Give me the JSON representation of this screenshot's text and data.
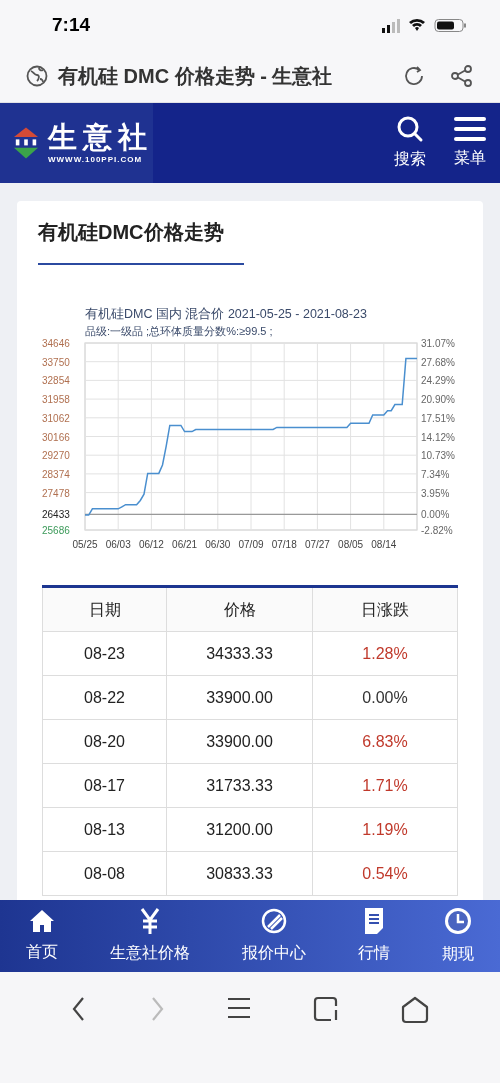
{
  "status_bar": {
    "time": "7:14"
  },
  "browser": {
    "page_title": "有机硅 DMC 价格走势 - 生意社"
  },
  "site_header": {
    "logo_name": "生意社",
    "logo_url": "WWWW.100PPI.COM",
    "actions": [
      {
        "label": "搜索",
        "kind": "search"
      },
      {
        "label": "菜单",
        "kind": "menu"
      }
    ]
  },
  "card": {
    "title": "有机硅DMC价格走势",
    "chart": {
      "subtitle": "品级:一级品 ;总环体质量分数%:≥99.5 ;",
      "right_axis_labels": [
        "31.07%",
        "27.68%",
        "24.29%",
        "20.90%",
        "17.51%",
        "14.12%",
        "10.73%",
        "7.34%",
        "3.95%",
        "0.00%",
        "-2.82%"
      ],
      "chart_data": {
        "type": "line",
        "title": "有机硅DMC 国内 混合价 2021-05-25 - 2021-08-23",
        "categories": [
          "05/25",
          null,
          null,
          null,
          null,
          null,
          null,
          null,
          null,
          "06/03",
          null,
          null,
          null,
          null,
          null,
          null,
          null,
          null,
          "06/12",
          null,
          null,
          null,
          null,
          null,
          null,
          null,
          null,
          "06/21",
          null,
          null,
          null,
          null,
          null,
          null,
          null,
          null,
          "06/30",
          null,
          null,
          null,
          null,
          null,
          null,
          null,
          null,
          "07/09",
          null,
          null,
          null,
          null,
          null,
          null,
          null,
          null,
          "07/18",
          null,
          null,
          null,
          null,
          null,
          null,
          null,
          null,
          "07/27",
          null,
          null,
          null,
          null,
          null,
          null,
          null,
          null,
          "08/05",
          null,
          null,
          null,
          null,
          null,
          null,
          null,
          null,
          "08/14",
          null,
          null,
          null,
          null,
          null,
          null,
          null,
          null,
          null
        ],
        "series": [
          {
            "color": "#4a8fcf",
            "values": [
              26400,
              26400,
              26700,
              26700,
              26700,
              26700,
              26700,
              26700,
              26700,
              26700,
              26800,
              26900,
              26900,
              26900,
              26900,
              27100,
              27400,
              28400,
              28400,
              28400,
              28400,
              28800,
              29700,
              30700,
              30700,
              30700,
              30700,
              30400,
              30400,
              30400,
              30500,
              30500,
              30500,
              30500,
              30500,
              30500,
              30500,
              30500,
              30500,
              30500,
              30500,
              30500,
              30500,
              30500,
              30500,
              30500,
              30500,
              30500,
              30500,
              30500,
              30500,
              30500,
              30600,
              30600,
              30600,
              30600,
              30600,
              30600,
              30600,
              30600,
              30600,
              30600,
              30600,
              30600,
              30600,
              30600,
              30600,
              30600,
              30600,
              30600,
              30600,
              30600,
              30800,
              30800,
              30800,
              30800,
              30800,
              30800,
              31200,
              31200,
              31200,
              31200,
              31400,
              31400,
              31700,
              31700,
              31700,
              33900,
              33900,
              33900,
              33900
            ]
          }
        ],
        "ylim": [
          25686,
          34646
        ],
        "grid": true,
        "ref_lines": [
          {
            "axis": "y",
            "value": 26433,
            "color": "#999999"
          }
        ],
        "yticks": [
          34646,
          33750,
          32854,
          31958,
          31062,
          30166,
          29270,
          28374,
          27478,
          26433,
          25686
        ]
      }
    },
    "table": {
      "columns": [
        "日期",
        "价格",
        "日涨跌"
      ],
      "rows": [
        {
          "date": "08-23",
          "price": "34333.33",
          "change": "1.28%",
          "color": "#c0392b"
        },
        {
          "date": "08-22",
          "price": "33900.00",
          "change": "0.00%",
          "color": "#333333"
        },
        {
          "date": "08-20",
          "price": "33900.00",
          "change": "6.83%",
          "color": "#c0392b"
        },
        {
          "date": "08-17",
          "price": "31733.33",
          "change": "1.71%",
          "color": "#c0392b"
        },
        {
          "date": "08-13",
          "price": "31200.00",
          "change": "1.19%",
          "color": "#c0392b"
        },
        {
          "date": "08-08",
          "price": "30833.33",
          "change": "0.54%",
          "color": "#c0392b"
        }
      ]
    }
  },
  "bottom_nav": [
    {
      "label": "首页",
      "kind": "home"
    },
    {
      "label": "生意社价格",
      "kind": "yen"
    },
    {
      "label": "报价中心",
      "kind": "quote"
    },
    {
      "label": "行情",
      "kind": "doc"
    },
    {
      "label": "期现",
      "kind": "clock"
    }
  ]
}
